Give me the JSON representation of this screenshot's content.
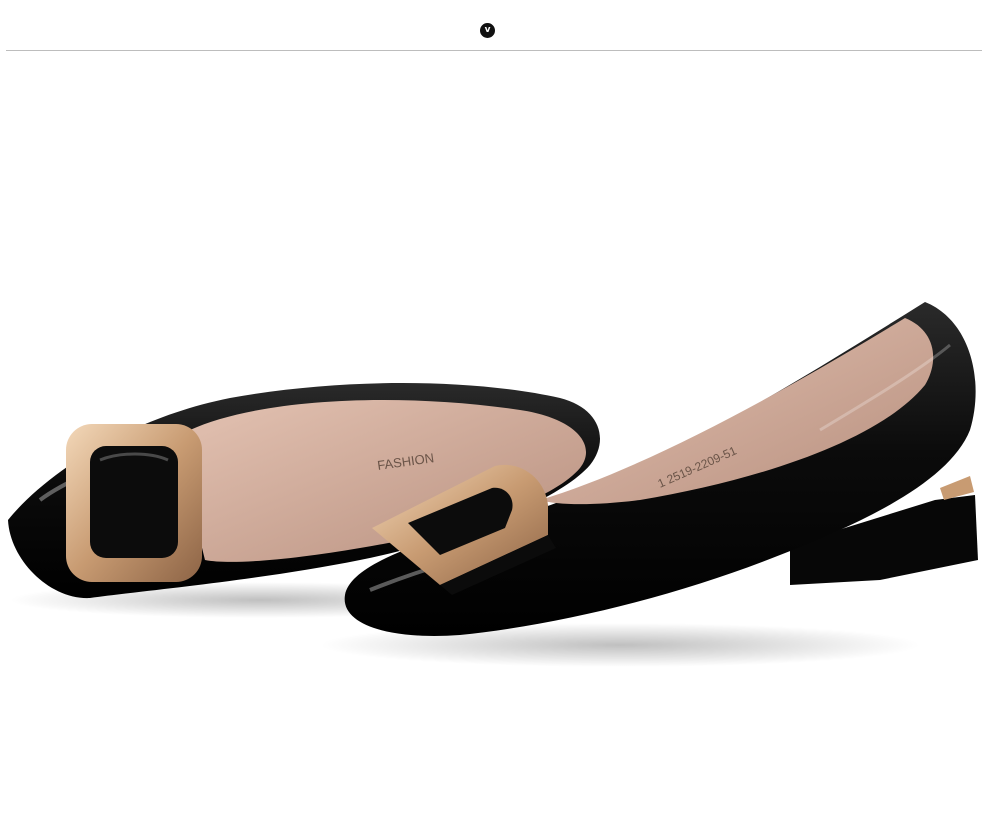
{
  "header": {
    "badge_label": "v"
  },
  "photo": {
    "insole_brand_text": "FASHION",
    "insole_code_text": "1 2519-2209-51",
    "colors": {
      "patent": "#0b0b0b",
      "lining": "#c9a08e",
      "buckle": "#c89b72"
    }
  }
}
